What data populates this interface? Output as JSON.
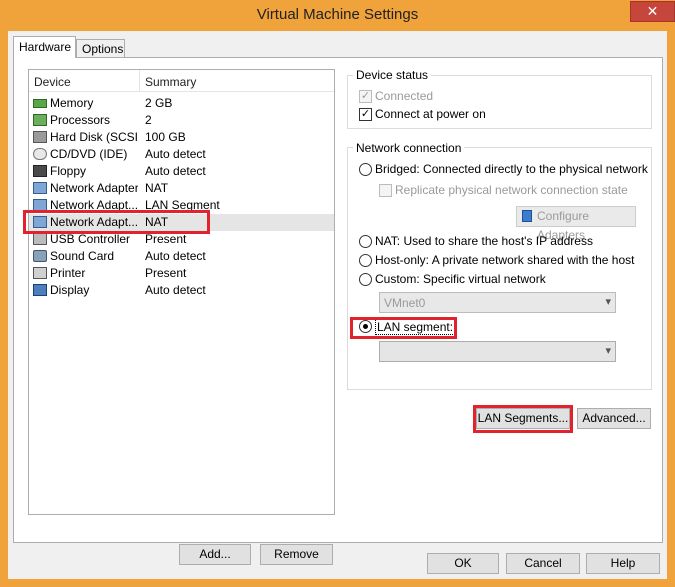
{
  "window": {
    "title": "Virtual Machine Settings",
    "close_glyph": "✕"
  },
  "tabs": [
    {
      "label": "Hardware"
    },
    {
      "label": "Options"
    }
  ],
  "device_list": {
    "headers": {
      "device": "Device",
      "summary": "Summary"
    },
    "rows": [
      {
        "device": "Memory",
        "summary": "2 GB",
        "icon": "memory-icon"
      },
      {
        "device": "Processors",
        "summary": "2",
        "icon": "cpu-icon"
      },
      {
        "device": "Hard Disk (SCSI)",
        "summary": "100 GB",
        "icon": "hard-disk-icon"
      },
      {
        "device": "CD/DVD (IDE)",
        "summary": "Auto detect",
        "icon": "cd-dvd-icon"
      },
      {
        "device": "Floppy",
        "summary": "Auto detect",
        "icon": "floppy-icon"
      },
      {
        "device": "Network Adapter",
        "summary": "NAT",
        "icon": "network-adapter-icon"
      },
      {
        "device": "Network Adapt...",
        "summary": "LAN Segment",
        "icon": "network-adapter-icon"
      },
      {
        "device": "Network Adapt...",
        "summary": "NAT",
        "icon": "network-adapter-icon",
        "selected": true
      },
      {
        "device": "USB Controller",
        "summary": "Present",
        "icon": "usb-icon"
      },
      {
        "device": "Sound Card",
        "summary": "Auto detect",
        "icon": "sound-card-icon"
      },
      {
        "device": "Printer",
        "summary": "Present",
        "icon": "printer-icon"
      },
      {
        "device": "Display",
        "summary": "Auto detect",
        "icon": "display-icon"
      }
    ]
  },
  "list_buttons": {
    "add": "Add...",
    "remove": "Remove"
  },
  "device_status": {
    "title": "Device status",
    "connected": "Connected",
    "connect_at_power_on": "Connect at power on"
  },
  "network_connection": {
    "title": "Network connection",
    "bridged": "Bridged: Connected directly to the physical network",
    "replicate": "Replicate physical network connection state",
    "configure_adapters": "Configure Adapters",
    "nat": "NAT: Used to share the host's IP address",
    "host_only": "Host-only: A private network shared with the host",
    "custom": "Custom: Specific virtual network",
    "vmnet_value": "VMnet0",
    "lan_segment": "LAN segment:",
    "lan_segment_value": ""
  },
  "panel_buttons": {
    "lan_segments": "LAN Segments...",
    "advanced": "Advanced..."
  },
  "footer": {
    "ok": "OK",
    "cancel": "Cancel",
    "help": "Help"
  },
  "colors": {
    "titlebar": "#f0a23b",
    "highlight": "#e0232d",
    "close": "#c7463b"
  }
}
